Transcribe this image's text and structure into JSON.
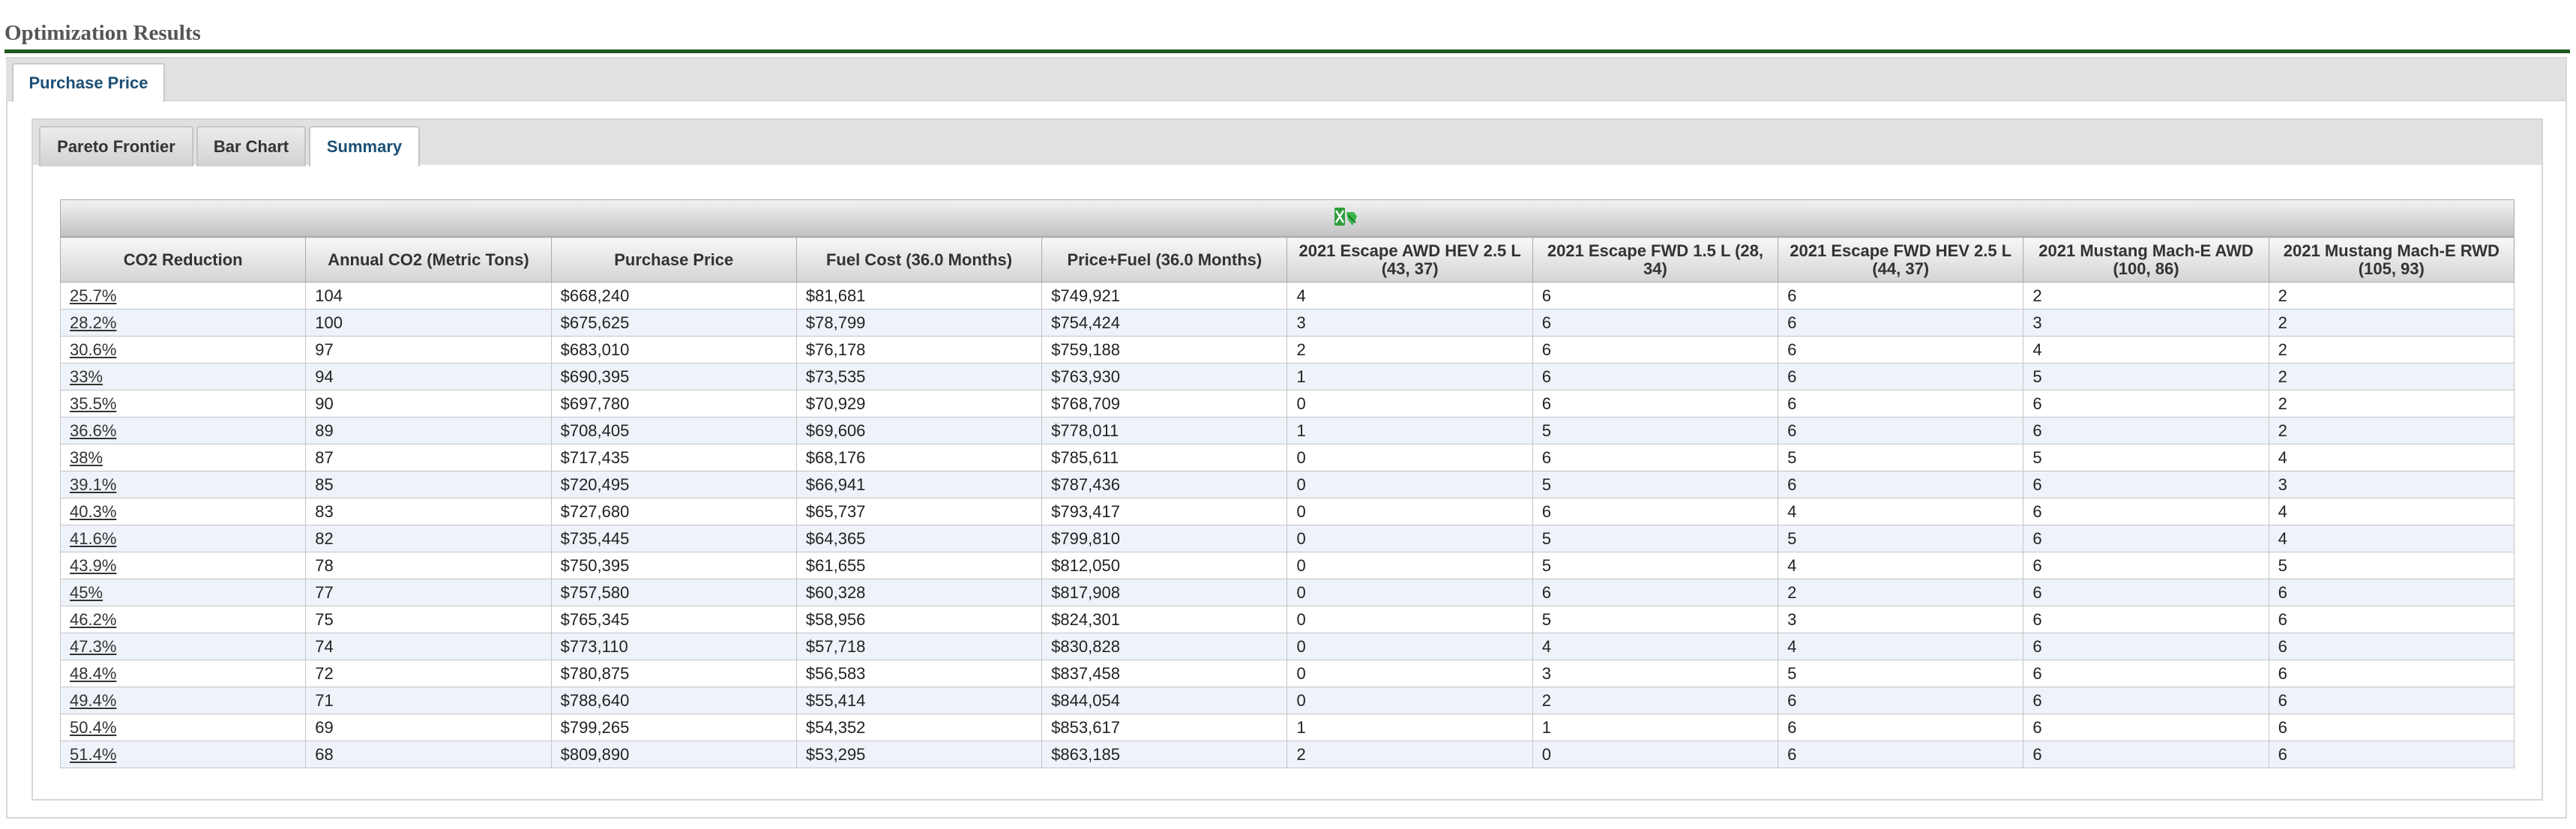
{
  "page": {
    "title": "Optimization Results"
  },
  "outer_tabs": [
    {
      "label": "Purchase Price"
    }
  ],
  "inner_tabs": [
    {
      "label": "Pareto Frontier"
    },
    {
      "label": "Bar Chart"
    },
    {
      "label": "Summary"
    }
  ],
  "export_icon": "excel-export-icon",
  "colors": {
    "accent_rule": "#1f5a1f",
    "tab_text": "#1c4f75",
    "row_alt": "#eef3fa"
  },
  "table": {
    "columns": [
      "CO2 Reduction",
      "Annual CO2 (Metric Tons)",
      "Purchase Price",
      "Fuel Cost (36.0 Months)",
      "Price+Fuel (36.0 Months)",
      "2021 Escape AWD HEV 2.5 L (43, 37)",
      "2021 Escape FWD 1.5 L (28, 34)",
      "2021 Escape FWD HEV 2.5 L (44, 37)",
      "2021 Mustang Mach-E AWD (100, 86)",
      "2021 Mustang Mach-E RWD (105, 93)"
    ],
    "rows": [
      [
        "25.7%",
        "104",
        "$668,240",
        "$81,681",
        "$749,921",
        "4",
        "6",
        "6",
        "2",
        "2"
      ],
      [
        "28.2%",
        "100",
        "$675,625",
        "$78,799",
        "$754,424",
        "3",
        "6",
        "6",
        "3",
        "2"
      ],
      [
        "30.6%",
        "97",
        "$683,010",
        "$76,178",
        "$759,188",
        "2",
        "6",
        "6",
        "4",
        "2"
      ],
      [
        "33%",
        "94",
        "$690,395",
        "$73,535",
        "$763,930",
        "1",
        "6",
        "6",
        "5",
        "2"
      ],
      [
        "35.5%",
        "90",
        "$697,780",
        "$70,929",
        "$768,709",
        "0",
        "6",
        "6",
        "6",
        "2"
      ],
      [
        "36.6%",
        "89",
        "$708,405",
        "$69,606",
        "$778,011",
        "1",
        "5",
        "6",
        "6",
        "2"
      ],
      [
        "38%",
        "87",
        "$717,435",
        "$68,176",
        "$785,611",
        "0",
        "6",
        "5",
        "5",
        "4"
      ],
      [
        "39.1%",
        "85",
        "$720,495",
        "$66,941",
        "$787,436",
        "0",
        "5",
        "6",
        "6",
        "3"
      ],
      [
        "40.3%",
        "83",
        "$727,680",
        "$65,737",
        "$793,417",
        "0",
        "6",
        "4",
        "6",
        "4"
      ],
      [
        "41.6%",
        "82",
        "$735,445",
        "$64,365",
        "$799,810",
        "0",
        "5",
        "5",
        "6",
        "4"
      ],
      [
        "43.9%",
        "78",
        "$750,395",
        "$61,655",
        "$812,050",
        "0",
        "5",
        "4",
        "6",
        "5"
      ],
      [
        "45%",
        "77",
        "$757,580",
        "$60,328",
        "$817,908",
        "0",
        "6",
        "2",
        "6",
        "6"
      ],
      [
        "46.2%",
        "75",
        "$765,345",
        "$58,956",
        "$824,301",
        "0",
        "5",
        "3",
        "6",
        "6"
      ],
      [
        "47.3%",
        "74",
        "$773,110",
        "$57,718",
        "$830,828",
        "0",
        "4",
        "4",
        "6",
        "6"
      ],
      [
        "48.4%",
        "72",
        "$780,875",
        "$56,583",
        "$837,458",
        "0",
        "3",
        "5",
        "6",
        "6"
      ],
      [
        "49.4%",
        "71",
        "$788,640",
        "$55,414",
        "$844,054",
        "0",
        "2",
        "6",
        "6",
        "6"
      ],
      [
        "50.4%",
        "69",
        "$799,265",
        "$54,352",
        "$853,617",
        "1",
        "1",
        "6",
        "6",
        "6"
      ],
      [
        "51.4%",
        "68",
        "$809,890",
        "$53,295",
        "$863,185",
        "2",
        "0",
        "6",
        "6",
        "6"
      ]
    ]
  }
}
